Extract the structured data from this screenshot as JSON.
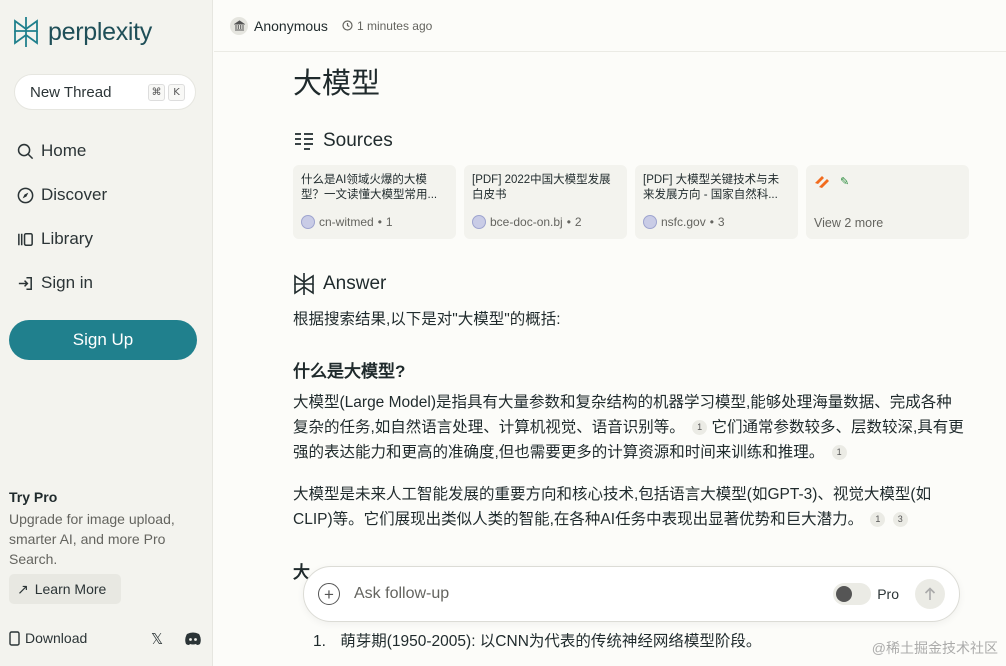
{
  "sidebar": {
    "logo_text": "perplexity",
    "new_thread": "New Thread",
    "shortcut_keys": [
      "⌘",
      "K"
    ],
    "nav": [
      {
        "label": "Home",
        "icon": "search-icon"
      },
      {
        "label": "Discover",
        "icon": "compass-icon"
      },
      {
        "label": "Library",
        "icon": "library-icon"
      },
      {
        "label": "Sign in",
        "icon": "sign-in-icon"
      }
    ],
    "signup": "Sign Up",
    "try_pro_title": "Try Pro",
    "try_pro_desc": "Upgrade for image upload, smarter AI, and more Pro Search.",
    "learn_more": "Learn More",
    "download": "Download"
  },
  "header": {
    "user": "Anonymous",
    "time": "1 minutes ago"
  },
  "main": {
    "title": "大模型",
    "sources_heading": "Sources",
    "sources": [
      {
        "title": "什么是AI领域火爆的大模型？一文读懂大模型常用...",
        "domain": "cn-witmed",
        "index": "1"
      },
      {
        "title": "[PDF] 2022中国大模型发展白皮书",
        "domain": "bce-doc-on.bj",
        "index": "2"
      },
      {
        "title": "[PDF] 大模型关键技术与未来发展方向 - 国家自然科...",
        "domain": "nsfc.gov",
        "index": "3"
      }
    ],
    "view_more": "View 2 more",
    "answer_heading": "Answer",
    "intro": "根据搜索结果,以下是对\"大模型\"的概括:",
    "h_what": "什么是大模型?",
    "p1": "大模型(Large Model)是指具有大量参数和复杂结构的机器学习模型,能够处理海量数据、完成各种复杂的任务,如自然语言处理、计算机视觉、语音识别等。",
    "p1_cite": "1",
    "p1b": "它们通常参数较多、层数较深,具有更强的表达能力和更高的准确度,但也需要更多的计算资源和时间来训练和推理。",
    "p1b_cite": "1",
    "p2": "大模型是未来人工智能发展的重要方向和核心技术,包括语言大模型(如GPT-3)、视觉大模型(如CLIP)等。它们展现出类似人类的智能,在各种AI任务中表现出显著优势和巨大潜力。",
    "p2_cites": [
      "1",
      "3"
    ],
    "partial_heading": "大",
    "list": [
      {
        "num": "1.",
        "text": "萌芽期(1950-2005): 以CNN为代表的传统神经网络模型阶段。"
      }
    ]
  },
  "followup": {
    "placeholder": "Ask follow-up",
    "pro_label": "Pro"
  },
  "watermark": "@稀土掘金技术社区"
}
